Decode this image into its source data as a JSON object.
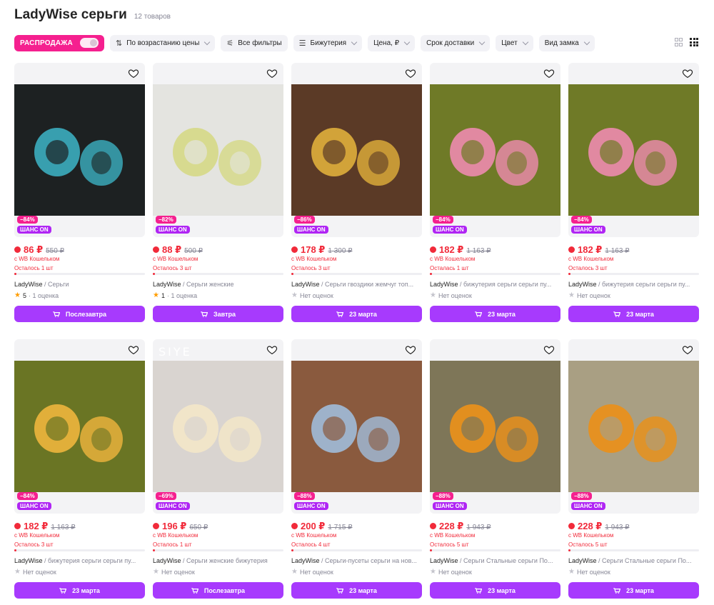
{
  "header": {
    "title": "LadyWise серьги",
    "count": "12 товаров"
  },
  "filters": {
    "sale": "РАСПРОДАЖА",
    "sort": "По возрастанию цены",
    "all_filters": "Все фильтры",
    "category": "Бижутерия",
    "price": "Цена, ₽",
    "delivery": "Срок доставки",
    "color": "Цвет",
    "lock": "Вид замка"
  },
  "products": [
    {
      "discount": "−84%",
      "chance": "ШАНС ON",
      "price": "86 ₽",
      "old_price": "550 ₽",
      "wallet": "с WB Кошельком",
      "stock": "Осталось 1 шт",
      "brand": "LadyWise",
      "desc": "Серьги",
      "rating": "5",
      "reviews": "· 1 оценка",
      "delivery": "Послезавтра",
      "img_bg": "#1d2122",
      "img_accent": "#3aa7b7"
    },
    {
      "discount": "−82%",
      "chance": "ШАНС ON",
      "price": "88 ₽",
      "old_price": "500 ₽",
      "wallet": "с WB Кошельком",
      "stock": "Осталось 3 шт",
      "brand": "LadyWise",
      "desc": "Серьги женские",
      "rating": "1",
      "reviews": "· 1 оценка",
      "delivery": "Завтра",
      "img_bg": "#e4e4e0",
      "img_accent": "#d6d98a"
    },
    {
      "discount": "−86%",
      "chance": "ШАНС ON",
      "price": "178 ₽",
      "old_price": "1 300 ₽",
      "wallet": "с WB Кошельком",
      "stock": "Осталось 3 шт",
      "brand": "LadyWise",
      "desc": "Серьги гвоздики жемчуг топ...",
      "rating": "",
      "reviews": "Нет оценок",
      "delivery": "23 марта",
      "img_bg": "#5b3a26",
      "img_accent": "#d9a93a"
    },
    {
      "discount": "−84%",
      "chance": "ШАНС ON",
      "price": "182 ₽",
      "old_price": "1 163 ₽",
      "wallet": "с WB Кошельком",
      "stock": "Осталась 1 шт",
      "brand": "LadyWise",
      "desc": "бижутерия серьги серьги пу...",
      "rating": "",
      "reviews": "Нет оценок",
      "delivery": "23 марта",
      "img_bg": "#6f7a27",
      "img_accent": "#e78aa8"
    },
    {
      "discount": "−84%",
      "chance": "ШАНС ON",
      "price": "182 ₽",
      "old_price": "1 163 ₽",
      "wallet": "с WB Кошельком",
      "stock": "Осталось 3 шт",
      "brand": "LadyWise",
      "desc": "бижутерия серьги серьги пу...",
      "rating": "",
      "reviews": "Нет оценок",
      "delivery": "23 марта",
      "img_bg": "#6f7a27",
      "img_accent": "#e78aa8"
    },
    {
      "discount": "−84%",
      "chance": "ШАНС ON",
      "price": "182 ₽",
      "old_price": "1 163 ₽",
      "wallet": "с WB Кошельком",
      "stock": "Осталось 3 шт",
      "brand": "LadyWise",
      "desc": "бижутерия серьги серьги пу...",
      "rating": "",
      "reviews": "Нет оценок",
      "delivery": "23 марта",
      "img_bg": "#6a7524",
      "img_accent": "#e8b23c"
    },
    {
      "discount": "−69%",
      "chance": "ШАНС ON",
      "price": "196 ₽",
      "old_price": "650 ₽",
      "wallet": "с WB Кошельком",
      "stock": "Осталось 1 шт",
      "brand": "LadyWise",
      "desc": "Серьги женские бижутерия",
      "rating": "",
      "reviews": "Нет оценок",
      "delivery": "Послезавтра",
      "img_bg": "#d9d4d0",
      "img_accent": "#f2e6c8",
      "logo": "SIYE"
    },
    {
      "discount": "−88%",
      "chance": "ШАНС ON",
      "price": "200 ₽",
      "old_price": "1 715 ₽",
      "wallet": "с WB Кошельком",
      "stock": "Осталось 4 шт",
      "brand": "LadyWise",
      "desc": "Серьги-пусеты серьги на нов...",
      "rating": "",
      "reviews": "Нет оценок",
      "delivery": "23 марта",
      "img_bg": "#8a5a3e",
      "img_accent": "#9fb7d2"
    },
    {
      "discount": "−88%",
      "chance": "ШАНС ON",
      "price": "228 ₽",
      "old_price": "1 943 ₽",
      "wallet": "с WB Кошельком",
      "stock": "Осталось 5 шт",
      "brand": "LadyWise",
      "desc": "Серьги Стальные серьги По...",
      "rating": "",
      "reviews": "Нет оценок",
      "delivery": "23 марта",
      "img_bg": "#7e7658",
      "img_accent": "#e8901c"
    },
    {
      "discount": "−88%",
      "chance": "ШАНС ON",
      "price": "228 ₽",
      "old_price": "1 943 ₽",
      "wallet": "с WB Кошельком",
      "stock": "Осталось 5 шт",
      "brand": "LadyWise",
      "desc": "Серьги Стальные серьги По...",
      "rating": "",
      "reviews": "Нет оценок",
      "delivery": "23 марта",
      "img_bg": "#a99f83",
      "img_accent": "#e8901c"
    }
  ]
}
